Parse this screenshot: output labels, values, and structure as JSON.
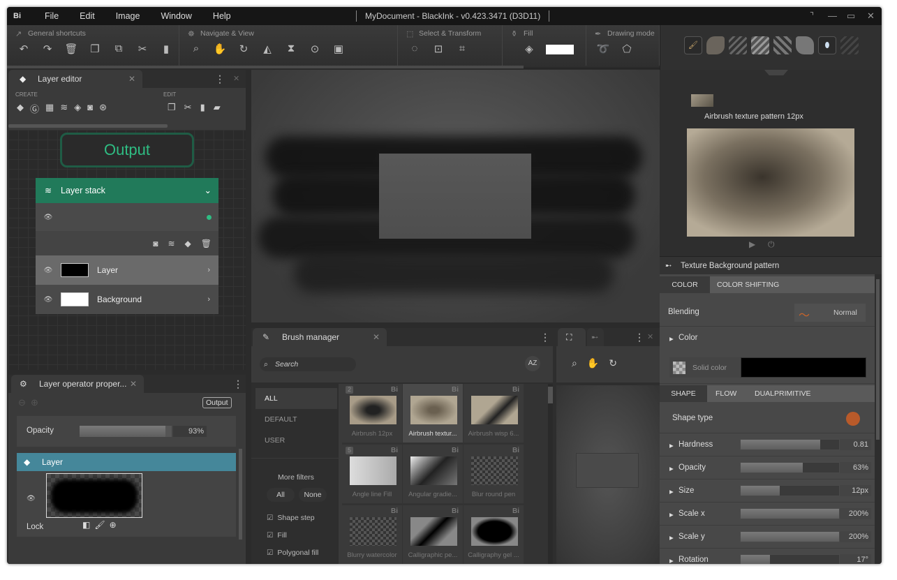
{
  "app": {
    "logo": "Bi",
    "title": "MyDocument - BlackInk  - v0.423.3471 (D3D11)"
  },
  "menu": [
    "File",
    "Edit",
    "Image",
    "Window",
    "Help"
  ],
  "toolbar": {
    "groups": [
      {
        "label": "General shortcuts",
        "icon": "pin-icon",
        "tools": [
          "undo-icon",
          "redo-icon",
          "trash-icon",
          "copy-icon",
          "duplicate-icon",
          "cut-icon",
          "paste-icon"
        ]
      },
      {
        "label": "Navigate & View",
        "icon": "helm-icon",
        "tools": [
          "zoom-icon",
          "pan-hand-icon",
          "rotate-hand-icon",
          "flip-horizontal-icon",
          "flip-vertical-icon",
          "zoom-target-icon",
          "fullscreen-icon"
        ]
      },
      {
        "label": "Select & Transform",
        "icon": "select-icon",
        "tools": [
          "lasso-select-icon",
          "transform-icon",
          "crop-icon"
        ]
      },
      {
        "label": "Fill",
        "icon": "fill-bucket-icon",
        "tools": [
          "fill-layer-icon"
        ]
      },
      {
        "label": "Drawing mode",
        "icon": "pen-icon",
        "tools": [
          "freehand-mode-icon",
          "polygon-mode-icon"
        ]
      }
    ],
    "fill_color": "#ffffff"
  },
  "layer_editor": {
    "tab": "Layer editor",
    "create_label": "CREATE",
    "edit_label": "EDIT",
    "output_node": "Output",
    "stack_title": "Layer stack",
    "layers": [
      {
        "name": "Layer",
        "thumb": "#000000"
      },
      {
        "name": "Background",
        "thumb": "#ffffff"
      }
    ],
    "accent": "#217a5a"
  },
  "layer_props": {
    "tab": "Layer operator proper...",
    "output_btn": "Output",
    "opacity_label": "Opacity",
    "opacity_value": "93%",
    "opacity": 0.93,
    "layer_title": "Layer",
    "lock_label": "Lock",
    "accent": "#45879a"
  },
  "brush_manager": {
    "tab": "Brush manager",
    "search_placeholder": "Search",
    "sort": "AZ",
    "categories": [
      "ALL",
      "DEFAULT",
      "USER"
    ],
    "more_filters": "More filters",
    "filter_all": "All",
    "filter_none": "None",
    "filters": [
      "Shape step",
      "Fill",
      "Polygonal fill"
    ],
    "brushes": [
      "Airbrush 12px",
      "Airbrush textur...",
      "Airbrush wisp 6...",
      "Angle line Fill",
      "Angular gradie...",
      "Blur round pen",
      "Blurry watercolor",
      "Calligraphic pe...",
      "Calligraphy gel ..."
    ],
    "badges": [
      "2",
      "",
      "",
      "5",
      "",
      "",
      "",
      "",
      ""
    ],
    "brand": "Bi"
  },
  "right_panel": {
    "brush_name": "Airbrush texture pattern 12px",
    "texture_title": "Texture Background pattern",
    "color_tabs": [
      "COLOR",
      "COLOR SHIFTING"
    ],
    "blending_label": "Blending",
    "blending_value": "Normal",
    "color_label": "Color",
    "solid_color_label": "Solid color",
    "solid_color": "#000000",
    "shape_tabs": [
      "SHAPE",
      "FLOW",
      "DUALPRIMITIVE"
    ],
    "shape_type_label": "Shape type",
    "shape_color": "#b85a2a",
    "params": [
      {
        "label": "Hardness",
        "value": "0.81",
        "level": 0.81
      },
      {
        "label": "Opacity",
        "value": "63%",
        "level": 0.63
      },
      {
        "label": "Size",
        "value": "12px",
        "level": 0.4
      },
      {
        "label": "Scale x",
        "value": "200%",
        "level": 1.0
      },
      {
        "label": "Scale y",
        "value": "200%",
        "level": 1.0
      },
      {
        "label": "Rotation",
        "value": "17°",
        "level": 0.3
      }
    ]
  }
}
